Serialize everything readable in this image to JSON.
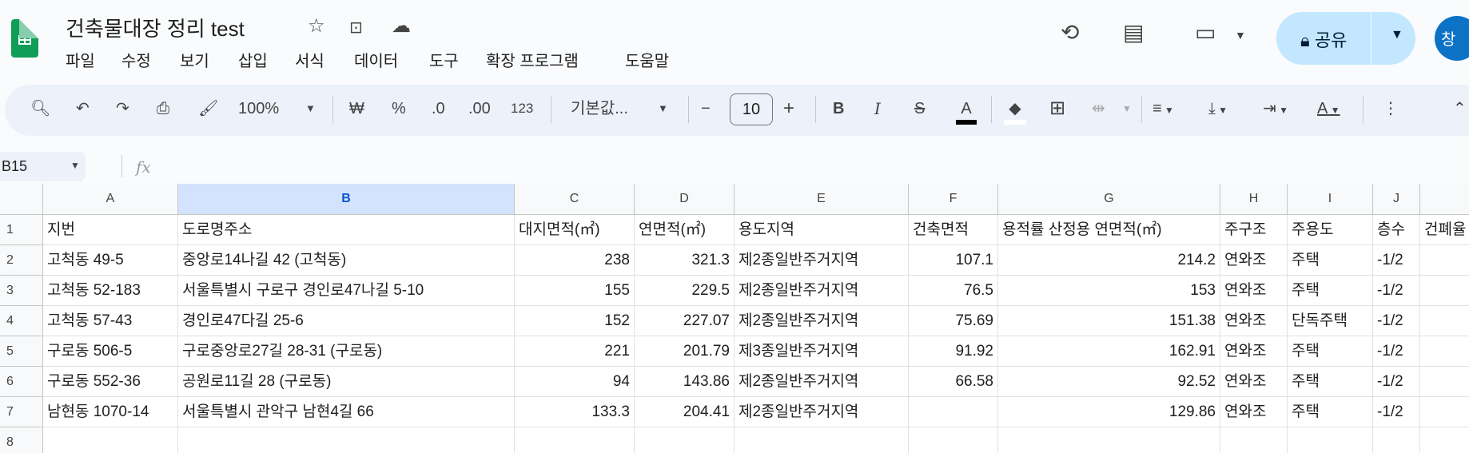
{
  "app": {
    "title": "건축물대장 정리 test",
    "icons": [
      "star-icon",
      "move-to-folder-icon",
      "cloud-saved-icon"
    ]
  },
  "menu": [
    "파일",
    "수정",
    "보기",
    "삽입",
    "서식",
    "데이터",
    "도구",
    "확장 프로그램",
    "도움말"
  ],
  "header_right": {
    "share_label": "공유",
    "avatar_initial": "창"
  },
  "toolbar": {
    "zoom": "100%",
    "currency": "₩",
    "percent": "%",
    "dec_decrease": ".0",
    "dec_increase": ".00",
    "number_format": "123",
    "font": "기본값...",
    "font_size": "10",
    "bold": "B",
    "italic": "I",
    "text_color": "A",
    "text_color_value": "#000000"
  },
  "formula_bar": {
    "name_box": "B15",
    "fx": "fx",
    "value": ""
  },
  "sheet": {
    "selected_column": "B",
    "columns": [
      "A",
      "B",
      "C",
      "D",
      "E",
      "F",
      "G",
      "H",
      "I",
      "J",
      ""
    ],
    "rows": [
      [
        "지번",
        "도로명주소",
        "대지면적(㎡)",
        "연면적(㎡)",
        "용도지역",
        "건축면적",
        "용적률 산정용 연면적(㎡)",
        "주구조",
        "주용도",
        "층수",
        "건폐율"
      ],
      [
        "고척동 49-5",
        "중앙로14나길 42 (고척동)",
        "238",
        "321.3",
        "제2종일반주거지역",
        "107.1",
        "214.2",
        "연와조",
        "주택",
        "-1/2",
        ""
      ],
      [
        "고척동 52-183",
        "서울특별시 구로구 경인로47나길 5-10",
        "155",
        "229.5",
        "제2종일반주거지역",
        "76.5",
        "153",
        "연와조",
        "주택",
        "-1/2",
        ""
      ],
      [
        "고척동 57-43",
        "경인로47다길 25-6",
        "152",
        "227.07",
        "제2종일반주거지역",
        "75.69",
        "151.38",
        "연와조",
        "단독주택",
        "-1/2",
        ""
      ],
      [
        "구로동 506-5",
        "구로중앙로27길 28-31 (구로동)",
        "221",
        "201.79",
        "제3종일반주거지역",
        "91.92",
        "162.91",
        "연와조",
        "주택",
        "-1/2",
        ""
      ],
      [
        "구로동 552-36",
        "공원로11길 28 (구로동)",
        "94",
        "143.86",
        "제2종일반주거지역",
        "66.58",
        "92.52",
        "연와조",
        "주택",
        "-1/2",
        ""
      ],
      [
        "남현동 1070-14",
        "서울특별시 관악구 남현4길 66",
        "133.3",
        "204.41",
        "제2종일반주거지역",
        "",
        "129.86",
        "연와조",
        "주택",
        "-1/2",
        ""
      ],
      [
        "",
        "",
        "",
        "",
        "",
        "",
        "",
        "",
        "",
        "",
        ""
      ]
    ]
  }
}
